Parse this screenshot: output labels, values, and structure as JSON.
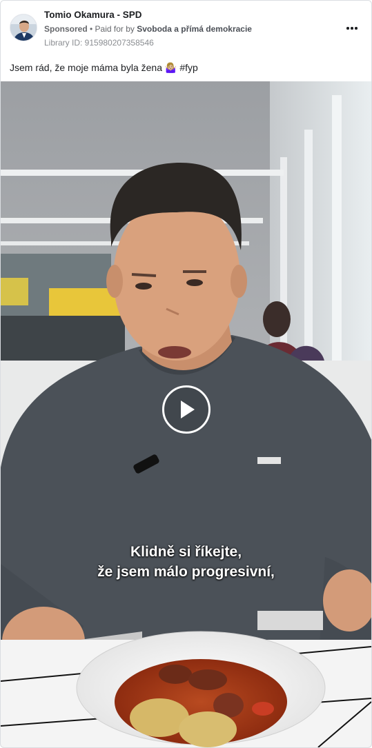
{
  "post": {
    "page_name": "Tomio Okamura - SPD",
    "sponsored_label": "Sponsored",
    "bullet": " • ",
    "paid_for_prefix": "Paid for by ",
    "payer": "Svoboda a přímá demokracie",
    "library_id_text": "Library ID: 915980207358546",
    "caption_text": "Jsem rád, že moje máma byla žena 🤷🏼‍♀️",
    "caption_hashtag": "#fyp"
  },
  "video": {
    "subtitle_line_1": "Klidně si říkejte,",
    "subtitle_line_2": "že jsem málo progresivní,"
  },
  "icons": {
    "avatar": "profile-photo",
    "more": "more-options-icon",
    "play": "play-icon"
  },
  "colors": {
    "text_primary": "#1c1e21",
    "text_secondary": "#65676b",
    "border": "#dadde1"
  }
}
